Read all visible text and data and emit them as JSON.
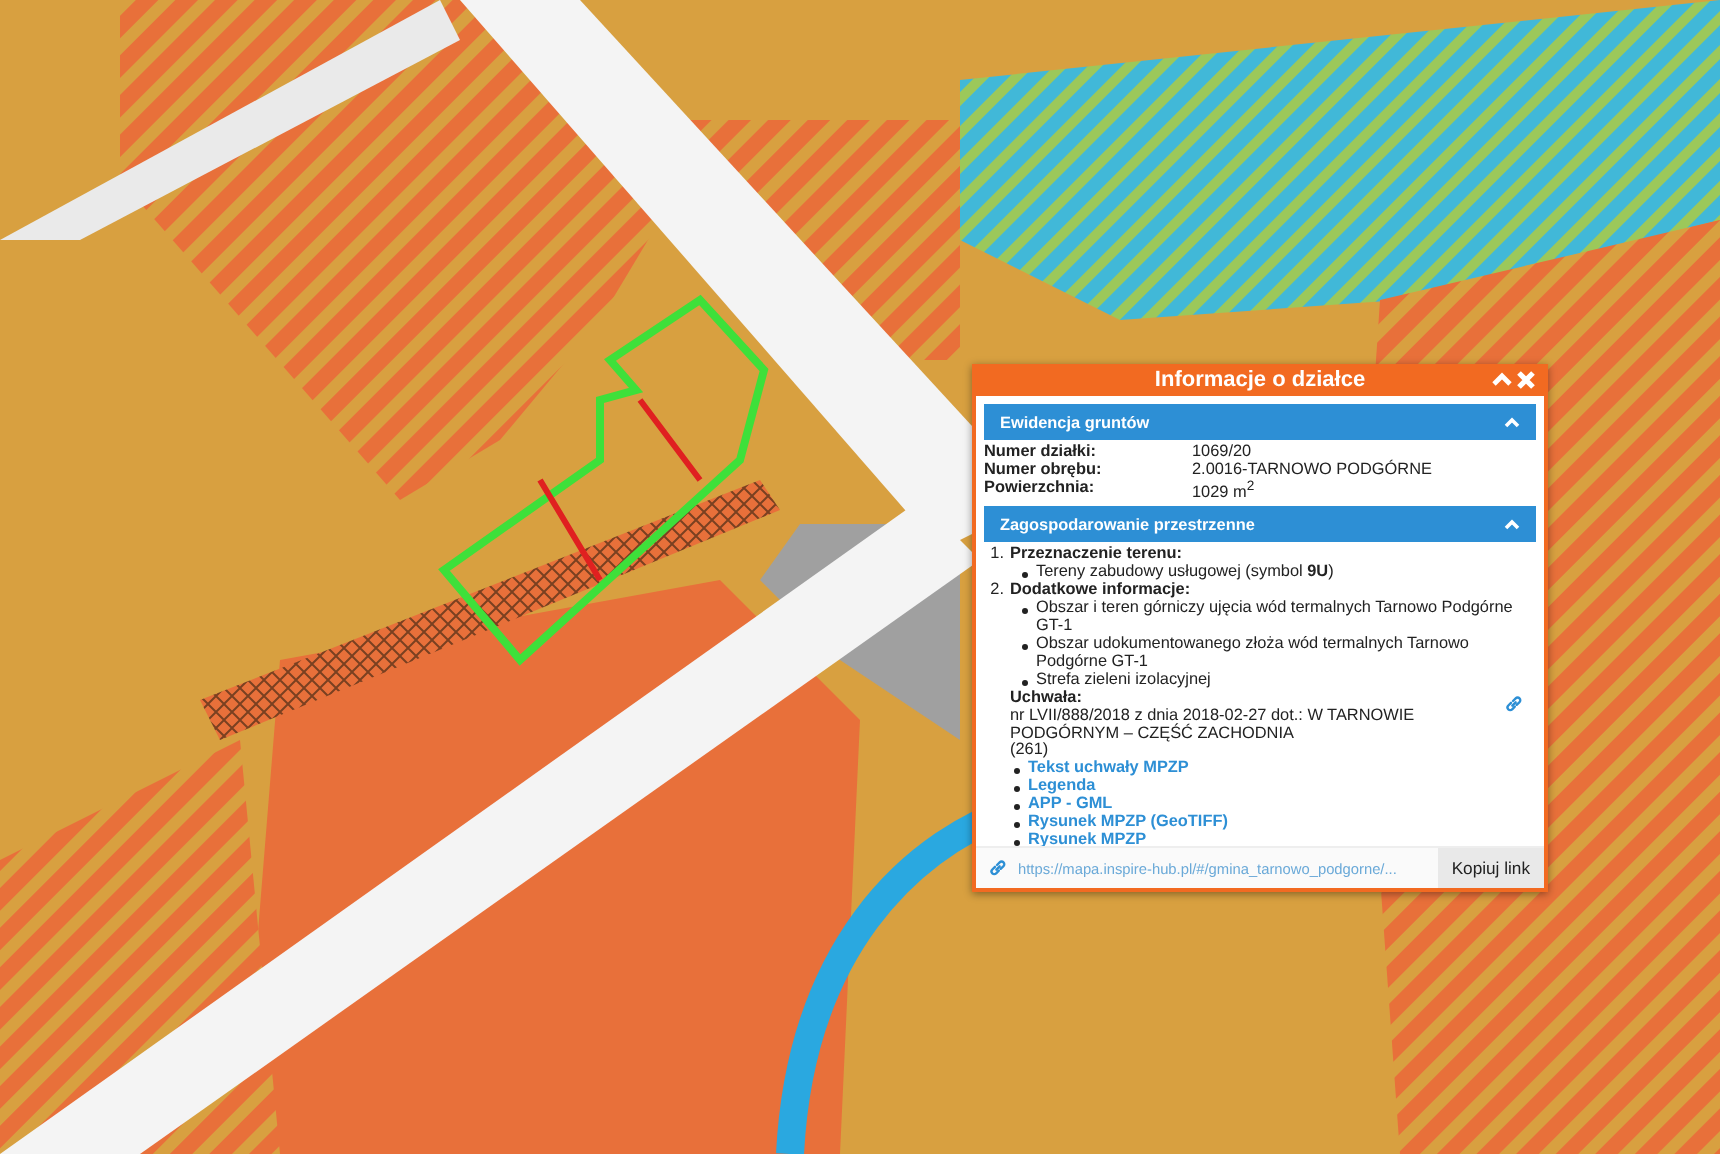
{
  "popup": {
    "title": "Informacje o działce",
    "sections": [
      {
        "kind": "fields",
        "title": "Ewidencja gruntów",
        "expanded": true,
        "fields": [
          {
            "label": "Numer działki:",
            "value": "1069/20"
          },
          {
            "label": "Numer obrębu:",
            "value": "2.0016-TARNOWO PODGÓRNE"
          },
          {
            "label": "Powierzchnia:",
            "value": "1029 m$^{2}$"
          }
        ]
      },
      {
        "kind": "plan",
        "title": "Zagospodarowanie przestrzenne",
        "expanded": true,
        "items": [
          {
            "number": "1.",
            "title": "Przeznaczenie terenu:",
            "bullets": [
              "Tereny zabudowy usługowej (symbol **9U**)"
            ]
          },
          {
            "number": "2.",
            "title": "Dodatkowe informacje:",
            "bullets": [
              "Obszar i teren górniczy ujęcia wód termalnych Tarnowo Podgórne GT-1",
              "Obszar udokumentowanego złoża wód termalnych Tarnowo Podgórne GT-1",
              "Strefa zieleni izolacyjnej"
            ]
          }
        ],
        "resolution": {
          "heading": "Uchwała:",
          "text": "nr LVII/888/2018 z dnia 2018-02-27 dot.: W TARNOWIE PODGÓRNYM – CZĘŚĆ ZACHODNIA",
          "number": "(261)",
          "links": [
            "Tekst uchwały MPZP",
            "Legenda",
            "APP - GML",
            "Rysunek MPZP (GeoTIFF)",
            "Rysunek MPZP"
          ]
        }
      }
    ],
    "share": {
      "url": "https://mapa.inspire-hub.pl/#/gmina_tarnowo_podgorne/...",
      "button": "Kopiuj link"
    }
  }
}
